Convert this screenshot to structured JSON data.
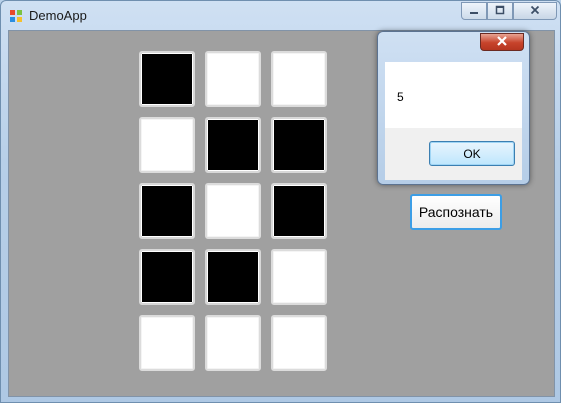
{
  "window": {
    "title": "DemoApp",
    "icon": "app-windows-icon",
    "controls": [
      "minimize-icon",
      "maximize-icon",
      "close-icon"
    ]
  },
  "grid": {
    "rows": 5,
    "cols": 3,
    "cells": [
      [
        1,
        0,
        0
      ],
      [
        0,
        1,
        1
      ],
      [
        1,
        0,
        1
      ],
      [
        1,
        1,
        0
      ],
      [
        0,
        0,
        0
      ]
    ],
    "colors": {
      "filled": "#000000",
      "empty": "#ffffff"
    }
  },
  "recognize_button": {
    "label": "Распознать"
  },
  "message_box": {
    "message": "5",
    "ok_label": "OK",
    "close_icon": "close-icon"
  },
  "colors": {
    "client_background": "#a0a0a0",
    "close_button": "#c7432b",
    "focus_border": "#3c9ee6"
  }
}
